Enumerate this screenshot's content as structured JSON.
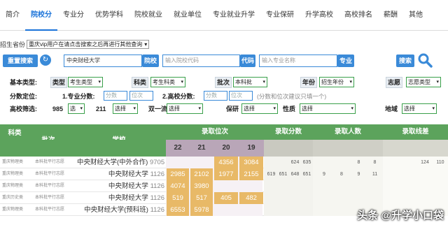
{
  "tabs": [
    "简介",
    "院校分",
    "专业分",
    "优势学科",
    "院校就业",
    "就业单位",
    "专业就业升学",
    "专业保研",
    "升学高校",
    "高校排名",
    "薪酬",
    "其他"
  ],
  "province": {
    "label": "招生省份",
    "value": "重庆vip用户在请点击搜索之后再进行其他查询"
  },
  "search": {
    "reset_label": "重置搜索",
    "school_input": "中央财经大学",
    "school_btn": "院校",
    "code_placeholder": "输入院校代码",
    "code_btn": "代码",
    "major_placeholder": "输入专业名称",
    "major_btn": "专业",
    "search_btn": "搜索"
  },
  "filters": {
    "basic_label": "基本类型:",
    "type_label": "类型",
    "type_value": "考生类型",
    "subject_label": "科类",
    "subject_value": "考生科类",
    "batch_label": "批次",
    "batch_value": "本科批",
    "year_label": "年份",
    "year_value": "招生年份",
    "wish_label": "志愿",
    "wish_value": "志愿类型",
    "score_label": "分数定位:",
    "s1_label": "1.专业分数:",
    "s1_a": "分数",
    "s1_b": "位次",
    "s2_label": "2.高校分数:",
    "s2_a": "分数",
    "s2_b": "位次",
    "score_hint": "(分数和位次建议只填一个)",
    "school_filter_label": "高校筛选:",
    "f985_label": "985",
    "f985_value": "选",
    "f211_label": "211",
    "f211_value": "选择",
    "double_label": "双一流",
    "double_value": "选择",
    "baoyan_label": "保研",
    "baoyan_value": "选择",
    "nature_label": "性质",
    "nature_value": "选择",
    "region_label": "地域",
    "region_value": "选择"
  },
  "table": {
    "headers": {
      "subject": "科类",
      "batch": "批次",
      "school": "学校",
      "rank": "录取位次",
      "score": "录取分数",
      "count": "录取人数",
      "line": "录取线差"
    },
    "years": [
      "22",
      "21",
      "20",
      "19"
    ],
    "rows": [
      {
        "subject": "重庆物理类",
        "batch": "本科批平行志愿",
        "school": "中央财经大学(中外合作)",
        "code": "9705",
        "rank": [
          "",
          "",
          "4356",
          "3084"
        ],
        "score": [
          "",
          "",
          "624",
          "635"
        ],
        "count": [
          "",
          "",
          "8",
          "8"
        ],
        "line": [
          "",
          "",
          "124",
          "110"
        ]
      },
      {
        "subject": "重庆物理类",
        "batch": "本科批平行志愿",
        "school": "中央财经大学",
        "code": "1126",
        "rank": [
          "2985",
          "2102",
          "1977",
          "2155"
        ],
        "score": [
          "619",
          "651",
          "648",
          "651"
        ],
        "count": [
          "9",
          "8",
          "9",
          "11"
        ],
        "line": [
          "",
          "",
          "",
          ""
        ]
      },
      {
        "subject": "重庆物理类",
        "batch": "本科批平行志愿",
        "school": "中央财经大学",
        "code": "1126",
        "rank": [
          "4074",
          "3980",
          "",
          ""
        ],
        "score": [
          "",
          "",
          "",
          ""
        ],
        "count": [
          "",
          "",
          "",
          ""
        ],
        "line": [
          "",
          "",
          "",
          ""
        ]
      },
      {
        "subject": "重庆历史类",
        "batch": "本科批平行志愿",
        "school": "中央财经大学",
        "code": "1126",
        "rank": [
          "519",
          "517",
          "405",
          "482"
        ],
        "score": [
          "",
          "",
          "",
          ""
        ],
        "count": [
          "",
          "",
          "",
          ""
        ],
        "line": [
          "",
          "",
          "",
          ""
        ]
      },
      {
        "subject": "重庆物理类",
        "batch": "本科批平行志愿",
        "school": "中央财经大学(预科班)",
        "code": "1126",
        "rank": [
          "6553",
          "5978",
          "",
          ""
        ],
        "score": [
          "",
          "",
          "",
          ""
        ],
        "count": [
          "",
          "",
          "",
          ""
        ],
        "line": [
          "",
          "",
          "",
          ""
        ]
      }
    ]
  },
  "watermark": "头条 @升学小口袋",
  "colors": {
    "accent": "#1a73d9",
    "header_green": "#5ca35c",
    "rank_highlight": "#e8b967"
  }
}
